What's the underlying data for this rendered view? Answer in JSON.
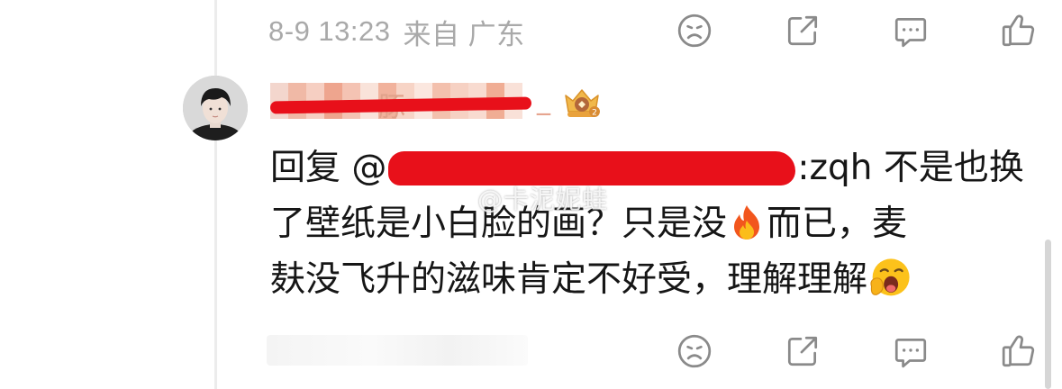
{
  "comment_top": {
    "date": "8-9 13:23",
    "location": "来自 广东"
  },
  "reply": {
    "username_visible": "豚",
    "username_suffix": "_",
    "reply_prefix": "回复",
    "mention_at": "@",
    "mention_tail": ":zqh",
    "line1_rest": "不是也换",
    "line2_a": "了壁纸是小白脸的画？只是没",
    "line2_b": "而已，麦",
    "line3": "麸没飞升的滋味肯定不好受，理解理解",
    "emoji_fire": "fire-emoji",
    "emoji_yawn": "yawning-face-emoji"
  },
  "watermark": "@卡泥妮蛙",
  "actions": {
    "icons": [
      "dislike-icon",
      "share-icon",
      "comment-icon",
      "like-icon"
    ]
  },
  "colors": {
    "meta_text": "#a9a9a9",
    "redaction": "#e8101a",
    "body_text": "#161616"
  }
}
